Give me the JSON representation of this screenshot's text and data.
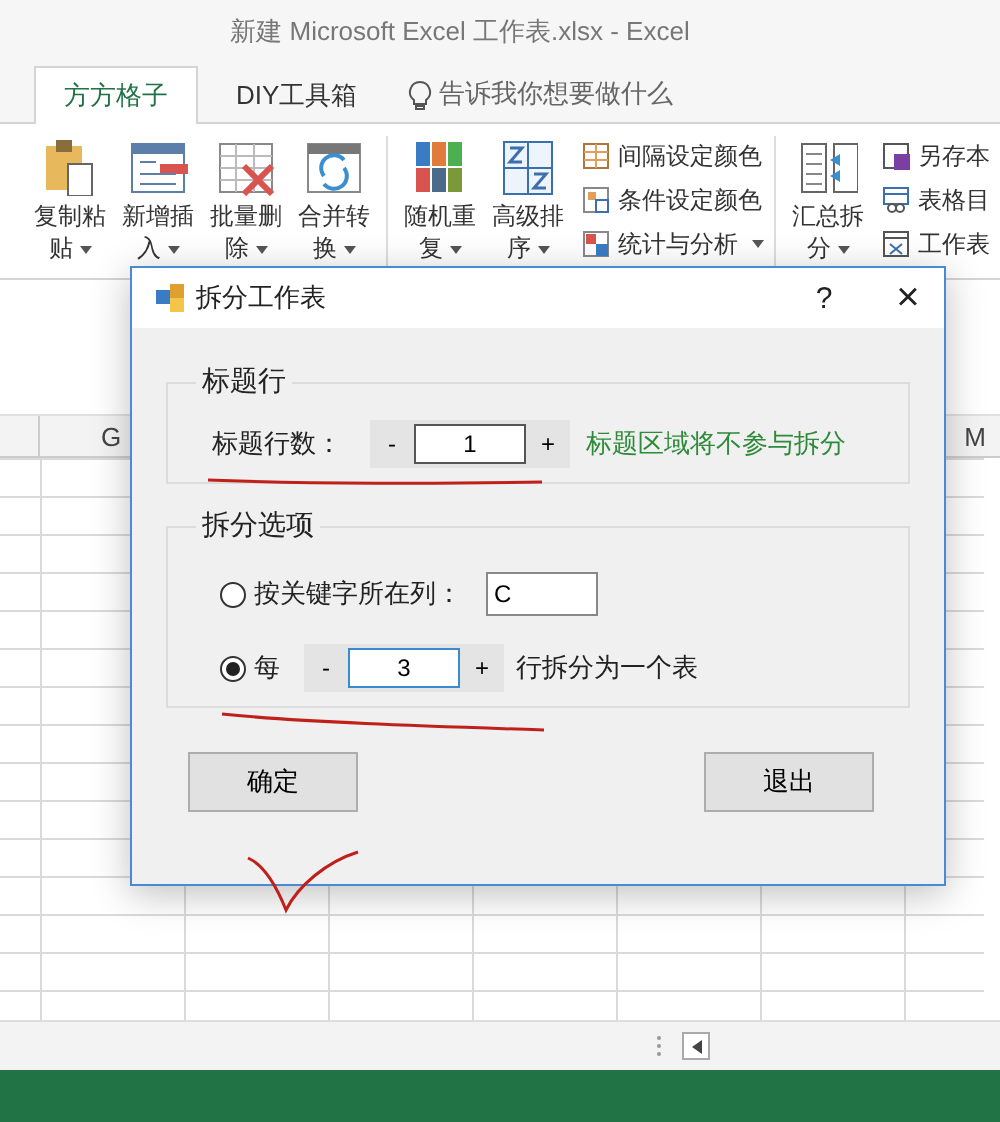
{
  "window": {
    "title": "新建 Microsoft Excel 工作表.xlsx - Excel"
  },
  "tabs": [
    {
      "label": "方方格子",
      "selected": true
    },
    {
      "label": "DIY工具箱",
      "selected": false
    }
  ],
  "tell_me": {
    "placeholder": "告诉我你想要做什么"
  },
  "ribbon": {
    "groups": [
      {
        "items": [
          {
            "kind": "large",
            "label": "复制粘贴",
            "dropdown": true
          },
          {
            "kind": "large",
            "label": "新增插入",
            "dropdown": true
          },
          {
            "kind": "large",
            "label": "批量删除",
            "dropdown": true
          },
          {
            "kind": "large",
            "label": "合并转换",
            "dropdown": true
          }
        ]
      },
      {
        "items": [
          {
            "kind": "large",
            "label": "随机重复",
            "dropdown": true
          },
          {
            "kind": "large",
            "label": "高级排序",
            "dropdown": true
          },
          {
            "kind": "small",
            "label": "间隔设定颜色",
            "dropdown": false
          },
          {
            "kind": "small",
            "label": "条件设定颜色",
            "dropdown": false
          },
          {
            "kind": "small",
            "label": "统计与分析",
            "dropdown": true
          }
        ]
      },
      {
        "items": [
          {
            "kind": "large",
            "label": "汇总拆分",
            "dropdown": true
          },
          {
            "kind": "small",
            "label": "另存本",
            "dropdown": false
          },
          {
            "kind": "small",
            "label": "表格目",
            "dropdown": false
          },
          {
            "kind": "small",
            "label": "工作表",
            "dropdown": false
          }
        ]
      }
    ]
  },
  "sheet": {
    "column_headers": [
      "G",
      "M"
    ]
  },
  "dialog": {
    "title": "拆分工作表",
    "help": "?",
    "close": "×",
    "header_group": {
      "title": "标题行",
      "label": "标题行数：",
      "minus": "-",
      "value": "1",
      "plus": "+",
      "hint": "标题区域将不参与拆分"
    },
    "split_group": {
      "title": "拆分选项",
      "options": [
        {
          "kind": "column",
          "selected": false,
          "label": "按关键字所在列：",
          "value": "C"
        },
        {
          "kind": "rows",
          "selected": true,
          "label": "每",
          "minus": "-",
          "value": "3",
          "plus": "+",
          "suffix": "行拆分为一个表"
        }
      ]
    },
    "buttons": [
      "确定",
      "退出"
    ]
  }
}
